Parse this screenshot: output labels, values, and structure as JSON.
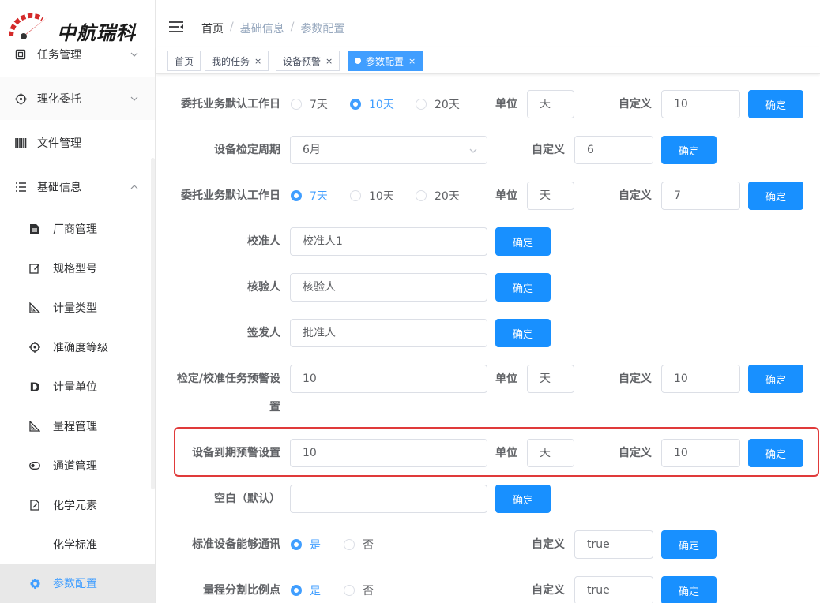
{
  "logo": {
    "text": "中航瑞科"
  },
  "sidebar": {
    "items": [
      {
        "label": "任务管理"
      },
      {
        "label": "理化委托"
      },
      {
        "label": "文件管理"
      },
      {
        "label": "基础信息"
      }
    ],
    "subitems": [
      {
        "label": "厂商管理"
      },
      {
        "label": "规格型号"
      },
      {
        "label": "计量类型"
      },
      {
        "label": "准确度等级"
      },
      {
        "label": "计量单位"
      },
      {
        "label": "量程管理"
      },
      {
        "label": "通道管理"
      },
      {
        "label": "化学元素"
      },
      {
        "label": "化学标准"
      },
      {
        "label": "参数配置"
      }
    ]
  },
  "breadcrumb": {
    "home": "首页",
    "sep": "/",
    "level2": "基础信息",
    "level3": "参数配置"
  },
  "tags": [
    {
      "label": "首页"
    },
    {
      "label": "我的任务",
      "close": "×"
    },
    {
      "label": "设备预警",
      "close": "×"
    },
    {
      "label": "参数配置",
      "close": "×"
    }
  ],
  "form": {
    "unit_label": "单位",
    "custom_label": "自定义",
    "confirm": "确定",
    "r1": {
      "label": "委托业务默认工作日",
      "options": [
        "7天",
        "10天",
        "20天"
      ],
      "selected": "10天",
      "unit": "天",
      "custom": "10"
    },
    "r2": {
      "label": "设备检定周期",
      "select": "6月",
      "custom": "6"
    },
    "r3": {
      "label": "委托业务默认工作日",
      "options": [
        "7天",
        "10天",
        "20天"
      ],
      "selected": "7天",
      "unit": "天",
      "custom": "7"
    },
    "r4": {
      "label": "校准人",
      "value": "校准人1"
    },
    "r5": {
      "label": "核验人",
      "value": "核验人"
    },
    "r6": {
      "label": "签发人",
      "value": "批准人"
    },
    "r7": {
      "label_line1": "检定/校准任务预警设",
      "label_line2": "置",
      "value": "10",
      "unit": "天",
      "custom": "10"
    },
    "r8": {
      "label": "设备到期预警设置",
      "value": "10",
      "unit": "天",
      "custom": "10"
    },
    "r9": {
      "label": "空白（默认）",
      "value": ""
    },
    "r10": {
      "label": "标准设备能够通讯",
      "options": [
        "是",
        "否"
      ],
      "selected": "是",
      "custom": "true"
    },
    "r11": {
      "label": "量程分割比例点",
      "options": [
        "是",
        "否"
      ],
      "selected": "是",
      "custom": "true"
    }
  },
  "colors": {
    "primary": "#1890ff",
    "active_text": "#409eff",
    "highlight": "#e03a3a"
  }
}
